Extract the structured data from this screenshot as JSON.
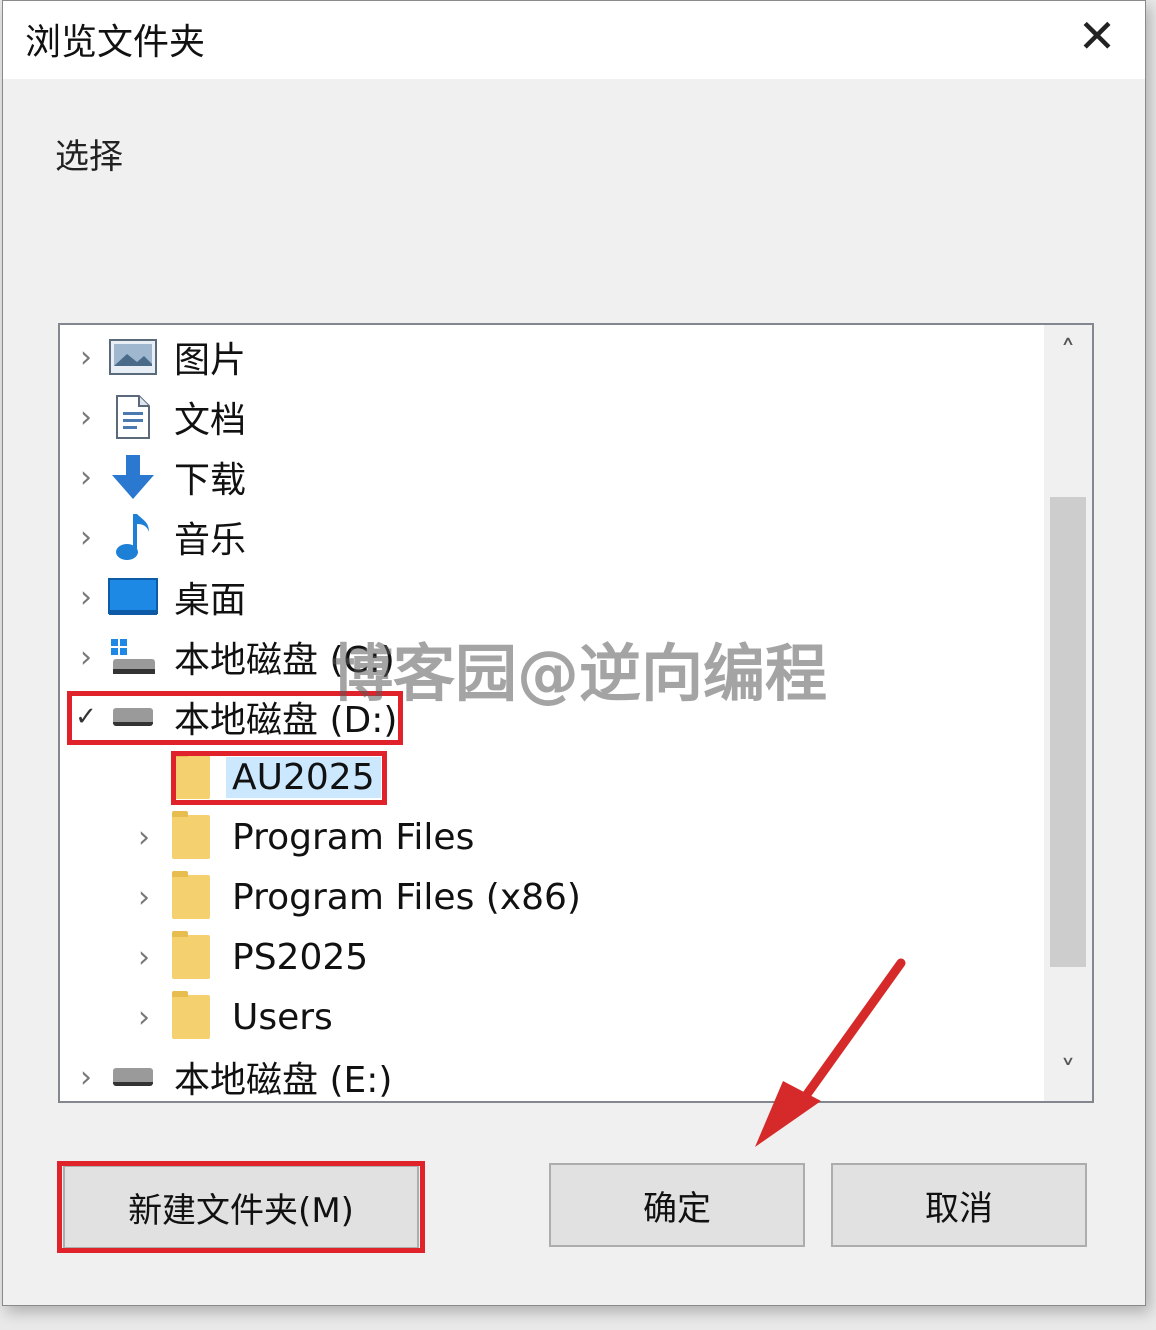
{
  "dialog": {
    "title": "浏览文件夹",
    "close_glyph": "✕",
    "instruction": "选择"
  },
  "tree": {
    "items": [
      {
        "label": "图片",
        "icon": "pictures-icon",
        "chevron": "›",
        "expanded": false
      },
      {
        "label": "文档",
        "icon": "documents-icon",
        "chevron": "›",
        "expanded": false
      },
      {
        "label": "下载",
        "icon": "download-arrow-icon",
        "chevron": "›",
        "expanded": false
      },
      {
        "label": "音乐",
        "icon": "music-note-icon",
        "chevron": "›",
        "expanded": false
      },
      {
        "label": "桌面",
        "icon": "desktop-icon",
        "chevron": "›",
        "expanded": false
      },
      {
        "label": "本地磁盘 (C:)",
        "icon": "windows-drive-icon",
        "chevron": "›",
        "expanded": false
      },
      {
        "label": "本地磁盘 (D:)",
        "icon": "drive-icon",
        "chevron": "✓",
        "expanded": true
      },
      {
        "label": "AU2025",
        "icon": "folder-icon",
        "chevron": "",
        "selected": true
      },
      {
        "label": "Program Files",
        "icon": "folder-icon",
        "chevron": "›"
      },
      {
        "label": "Program Files (x86)",
        "icon": "folder-icon",
        "chevron": "›"
      },
      {
        "label": "PS2025",
        "icon": "folder-icon",
        "chevron": "›"
      },
      {
        "label": "Users",
        "icon": "folder-icon",
        "chevron": "›"
      },
      {
        "label": "本地磁盘 (E:)",
        "icon": "drive-icon",
        "chevron": "›",
        "expanded": false
      }
    ],
    "scroll_up_glyph": "˄",
    "scroll_down_glyph": "˅"
  },
  "buttons": {
    "new_folder": "新建文件夹(M)",
    "ok": "确定",
    "cancel": "取消"
  },
  "watermark": "博客园@逆向编程",
  "colors": {
    "highlight": "#e0232a",
    "selection": "#cce8ff",
    "arrow": "#d62a2a"
  }
}
